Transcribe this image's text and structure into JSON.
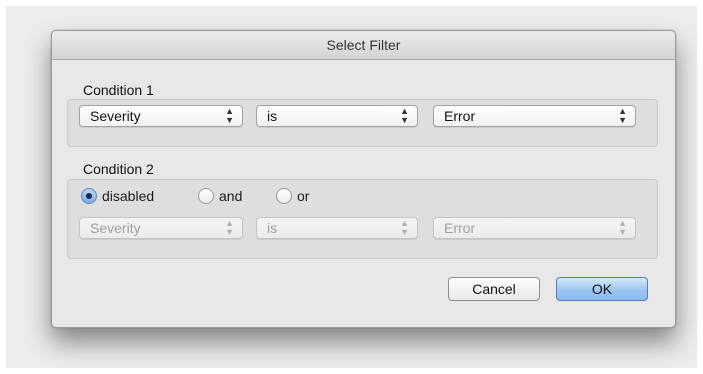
{
  "dialog": {
    "title": "Select Filter",
    "condition1": {
      "heading": "Condition 1",
      "field": "Severity",
      "operator": "is",
      "value": "Error"
    },
    "condition2": {
      "heading": "Condition 2",
      "radios": [
        {
          "label": "disabled",
          "selected": true
        },
        {
          "label": "and",
          "selected": false
        },
        {
          "label": "or",
          "selected": false
        }
      ],
      "field": "Severity",
      "operator": "is",
      "value": "Error",
      "disabled": true
    },
    "buttons": {
      "cancel": "Cancel",
      "ok": "OK"
    },
    "colors": {
      "accent": "#9cc6f0",
      "disabled_text": "#a0a0a0"
    }
  }
}
